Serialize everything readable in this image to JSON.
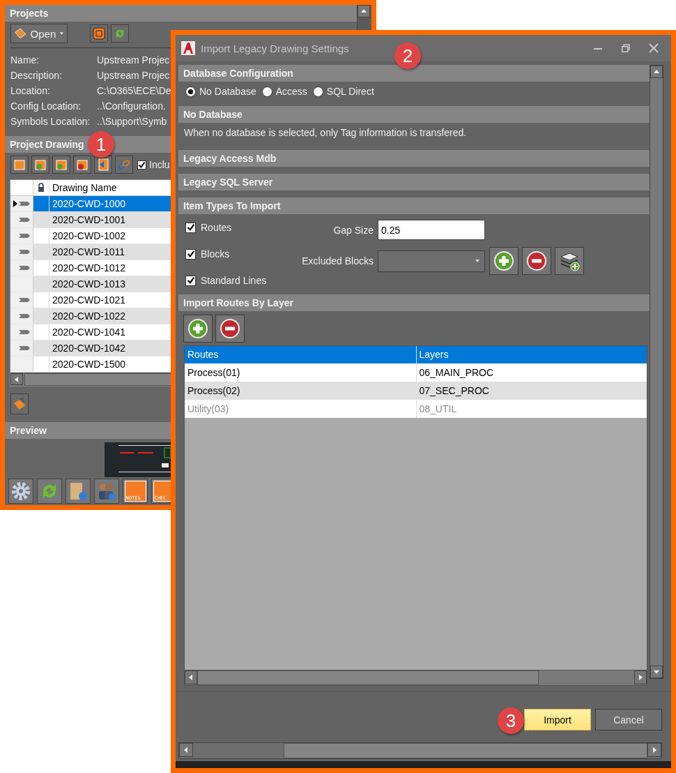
{
  "projects_panel": {
    "title": "Projects",
    "open_button": "Open",
    "info": [
      {
        "label": "Name:",
        "value": "Upstream Projec"
      },
      {
        "label": "Description:",
        "value": "Upstream Projec"
      },
      {
        "label": "Location:",
        "value": "C:\\O365\\ECE\\De"
      },
      {
        "label": "Config Location:",
        "value": "..\\Configuration."
      },
      {
        "label": "Symbols Location:",
        "value": "..\\Support\\Symb"
      }
    ],
    "drawings_title": "Project Drawing",
    "include_checkbox": {
      "label": "Inclu",
      "checked": true
    },
    "grid": {
      "column": "Drawing Name",
      "rows": [
        {
          "name": "2020-CWD-1000",
          "selected": true,
          "linked": true
        },
        {
          "name": "2020-CWD-1001",
          "selected": false,
          "linked": true
        },
        {
          "name": "2020-CWD-1002",
          "selected": false,
          "linked": true
        },
        {
          "name": "2020-CWD-1011",
          "selected": false,
          "linked": true
        },
        {
          "name": "2020-CWD-1012",
          "selected": false,
          "linked": true
        },
        {
          "name": "2020-CWD-1013",
          "selected": false,
          "linked": false
        },
        {
          "name": "2020-CWD-1021",
          "selected": false,
          "linked": true
        },
        {
          "name": "2020-CWD-1022",
          "selected": false,
          "linked": true
        },
        {
          "name": "2020-CWD-1041",
          "selected": false,
          "linked": true
        },
        {
          "name": "2020-CWD-1042",
          "selected": false,
          "linked": true
        },
        {
          "name": "2020-CWD-1500",
          "selected": false,
          "linked": false
        }
      ]
    },
    "preview_title": "Preview",
    "bottom_tools": [
      {
        "kind": "gear"
      },
      {
        "kind": "refresh"
      },
      {
        "kind": "book"
      },
      {
        "kind": "users"
      },
      {
        "kind": "cloud",
        "label": "NOTES"
      },
      {
        "kind": "cloud",
        "label": "CHEC"
      }
    ]
  },
  "dialog": {
    "title": "Import Legacy Drawing Settings",
    "database": {
      "title": "Database Configuration",
      "options": [
        {
          "label": "No Database",
          "selected": true
        },
        {
          "label": "Access",
          "selected": false
        },
        {
          "label": "SQL Direct",
          "selected": false
        }
      ]
    },
    "no_database": {
      "title": "No Database",
      "text": "When no database is selected, only Tag information is transfered."
    },
    "collapsed_sections": [
      "Legacy Access Mdb",
      "Legacy SQL Server"
    ],
    "item_types": {
      "title": "Item Types To Import",
      "checkboxes": [
        {
          "label": "Routes",
          "checked": true
        },
        {
          "label": "Blocks",
          "checked": true
        },
        {
          "label": "Standard Lines",
          "checked": true
        }
      ],
      "gap_size": {
        "label": "Gap Size",
        "value": "0.25"
      },
      "excluded_blocks": {
        "label": "Excluded Blocks"
      }
    },
    "routes_by_layer": {
      "title": "Import Routes By Layer",
      "columns": [
        "Routes",
        "Layers"
      ],
      "rows": [
        {
          "route": "Process(01)",
          "layer": "06_MAIN_PROC",
          "disabled": false
        },
        {
          "route": "Process(02)",
          "layer": "07_SEC_PROC",
          "disabled": false
        },
        {
          "route": "Utility(03)",
          "layer": "08_UTIL",
          "disabled": true
        }
      ]
    },
    "buttons": [
      {
        "label": "Import",
        "kind": "primary"
      },
      {
        "label": "Cancel",
        "kind": "secondary"
      }
    ]
  },
  "callouts": [
    "1",
    "2",
    "3"
  ]
}
